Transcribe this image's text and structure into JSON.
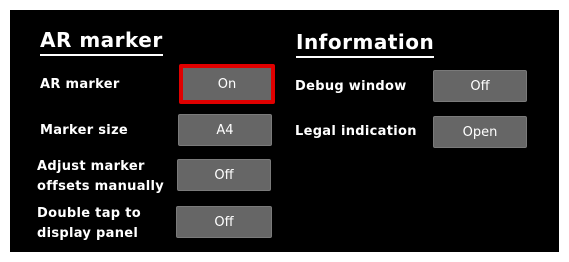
{
  "ar_section": {
    "heading": "AR marker",
    "rows": [
      {
        "label": "AR marker",
        "value": "On",
        "selected": true
      },
      {
        "label": "Marker size",
        "value": "A4",
        "selected": false
      },
      {
        "label_line1": "Adjust marker",
        "label_line2": "offsets manually",
        "value": "Off",
        "selected": false
      },
      {
        "label_line1": "Double tap to",
        "label_line2": "display panel",
        "value": "Off",
        "selected": false
      }
    ]
  },
  "info_section": {
    "heading": "Information",
    "rows": [
      {
        "label": "Debug window",
        "value": "Off"
      },
      {
        "label": "Legal indication",
        "value": "Open"
      }
    ]
  },
  "colors": {
    "background": "#000000",
    "button": "#666666",
    "focus_outline": "#e00000",
    "text": "#ffffff"
  }
}
